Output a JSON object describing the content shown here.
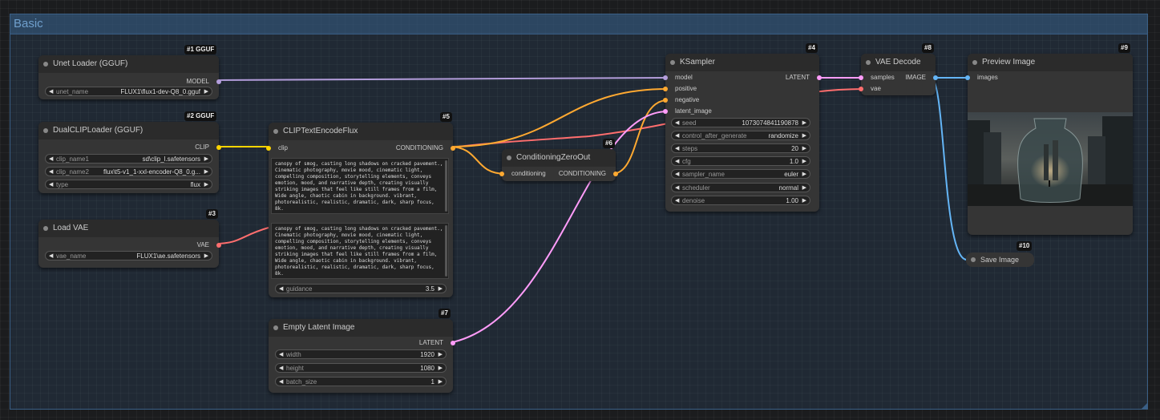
{
  "group": {
    "title": "Basic"
  },
  "colors": {
    "model": "#b39ddb",
    "clip": "#ffd500",
    "vae": "#ff6e6e",
    "conditioning": "#ffa931",
    "latent": "#ff9cf9",
    "image": "#64b5f6"
  },
  "nodes": {
    "unet": {
      "id": "#1 GGUF",
      "title": "Unet Loader (GGUF)",
      "output": "MODEL",
      "widgets": [
        {
          "name": "unet_name",
          "value": "FLUX1\\flux1-dev-Q8_0.gguf"
        }
      ]
    },
    "dualclip": {
      "id": "#2 GGUF",
      "title": "DualCLIPLoader (GGUF)",
      "output": "CLIP",
      "widgets": [
        {
          "name": "clip_name1",
          "value": "sd\\clip_l.safetensors"
        },
        {
          "name": "clip_name2",
          "value": "flux\\t5-v1_1-xxl-encoder-Q8_0.g..."
        },
        {
          "name": "type",
          "value": "flux"
        }
      ]
    },
    "loadvae": {
      "id": "#3",
      "title": "Load VAE",
      "output": "VAE",
      "widgets": [
        {
          "name": "vae_name",
          "value": "FLUX1\\ae.safetensors"
        }
      ]
    },
    "clipencode": {
      "id": "#5",
      "title": "CLIPTextEncodeFlux",
      "input": "clip",
      "output": "CONDITIONING",
      "text1": "canopy of smog, casting long shadows on cracked pavement., Cinematic photography, movie mood, cinematic light, compelling composition, storytelling elements, conveys emotion, mood, and narrative depth, creating visually striking images that feel like still frames from a film, Wide angle, chaotic cabin in background. vibrant, photorealistic, realistic, dramatic, dark, sharp focus, 8k.",
      "text2": "canopy of smog, casting long shadows on cracked pavement., Cinematic photography, movie mood, cinematic light, compelling composition, storytelling elements, conveys emotion, mood, and narrative depth, creating visually striking images that feel like still frames from a film, Wide angle, chaotic cabin in background. vibrant, photorealistic, realistic, dramatic, dark, sharp focus, 8k.",
      "widgets": [
        {
          "name": "guidance",
          "value": "3.5"
        }
      ]
    },
    "condzero": {
      "id": "#6",
      "title": "ConditioningZeroOut",
      "input": "conditioning",
      "output": "CONDITIONING"
    },
    "ksampler": {
      "id": "#4",
      "title": "KSampler",
      "inputs": [
        "model",
        "positive",
        "negative",
        "latent_image"
      ],
      "output": "LATENT",
      "widgets": [
        {
          "name": "seed",
          "value": "1073074841190878"
        },
        {
          "name": "control_after_generate",
          "value": "randomize"
        },
        {
          "name": "steps",
          "value": "20"
        },
        {
          "name": "cfg",
          "value": "1.0"
        },
        {
          "name": "sampler_name",
          "value": "euler"
        },
        {
          "name": "scheduler",
          "value": "normal"
        },
        {
          "name": "denoise",
          "value": "1.00"
        }
      ]
    },
    "vaedecode": {
      "id": "#8",
      "title": "VAE Decode",
      "inputs": [
        "samples",
        "vae"
      ],
      "output": "IMAGE"
    },
    "preview": {
      "id": "#9",
      "title": "Preview Image",
      "input": "images"
    },
    "save": {
      "id": "#10",
      "title": "Save Image"
    },
    "emptylatent": {
      "id": "#7",
      "title": "Empty Latent Image",
      "output": "LATENT",
      "widgets": [
        {
          "name": "width",
          "value": "1920"
        },
        {
          "name": "height",
          "value": "1080"
        },
        {
          "name": "batch_size",
          "value": "1"
        }
      ]
    }
  }
}
